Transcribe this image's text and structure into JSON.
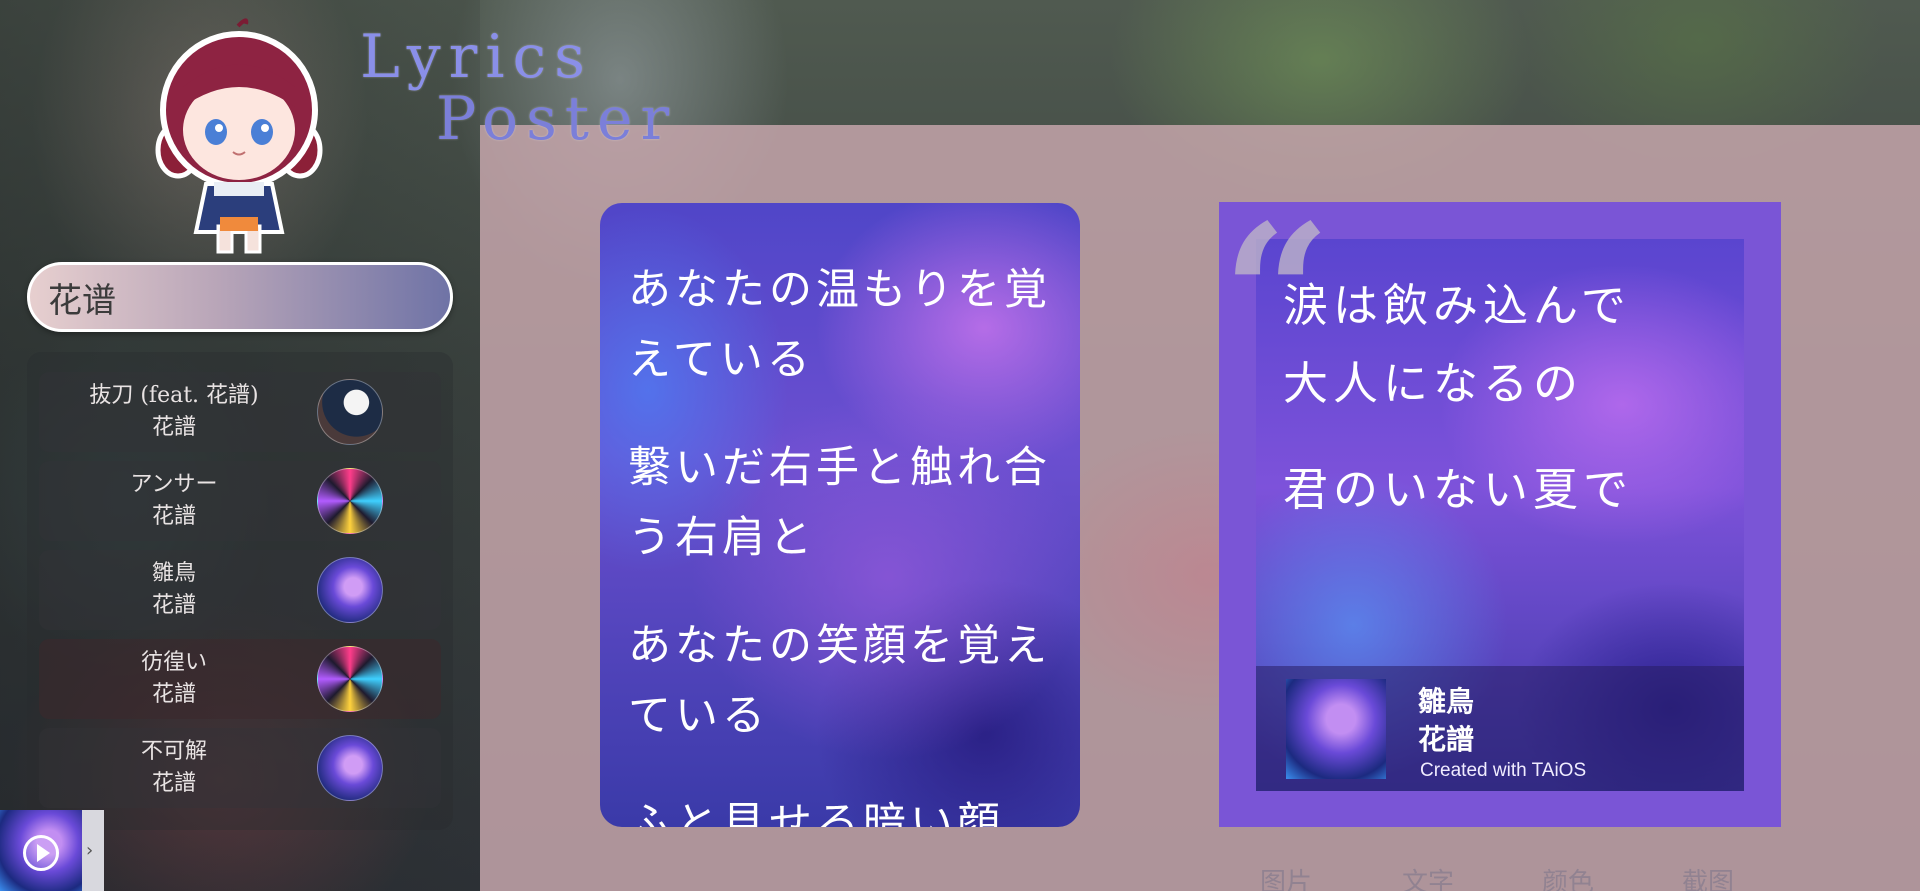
{
  "app": {
    "title_line1": "Lyrics",
    "title_line2": "Poster"
  },
  "search": {
    "value": "花谱",
    "placeholder": ""
  },
  "results": [
    {
      "title": "抜刀 (feat. 花譜)",
      "artist": "花譜",
      "cover": "thumb-a"
    },
    {
      "title": "アンサー",
      "artist": "花譜",
      "cover": "thumb-b"
    },
    {
      "title": "雛鳥",
      "artist": "花譜",
      "cover": "thumb-c"
    },
    {
      "title": "彷徨い",
      "artist": "花譜",
      "cover": "thumb-b"
    },
    {
      "title": "不可解",
      "artist": "花譜",
      "cover": "thumb-c"
    }
  ],
  "player": {
    "play_icon": "play-circle-icon",
    "expand_icon": "chevron-right-icon",
    "expand_glyph": "›"
  },
  "lyrics_card": {
    "lines": [
      "あなたの温もりを覚えている",
      "繋いだ右手と触れ合う右肩と",
      "あなたの笑顔を覚えている",
      "ふと見せる暗い顔"
    ]
  },
  "poster": {
    "quote_glyph": "“",
    "lines": [
      "涙は飲み込んで",
      "大人になるの",
      "君のいない夏で"
    ],
    "song_title": "雛鳥",
    "artist": "花譜",
    "credit": "Created with TAiOS",
    "border_color": "#7a55d6"
  },
  "tabs": [
    "图片",
    "文字",
    "颜色",
    "截图"
  ]
}
